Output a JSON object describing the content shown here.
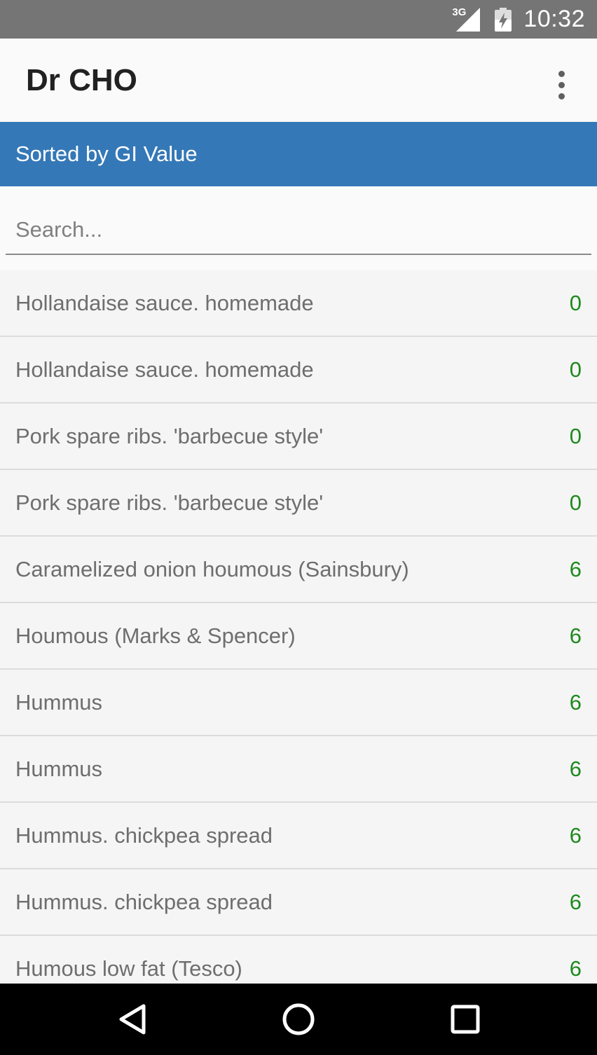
{
  "status_bar": {
    "network_type": "3G",
    "time": "10:32",
    "icons": [
      "signal-icon",
      "battery-charging-icon"
    ]
  },
  "app_bar": {
    "title": "Dr CHO",
    "menu_icon": "more-vert-icon"
  },
  "sort_banner": {
    "label": "Sorted by GI Value",
    "background": "#3478b7"
  },
  "search": {
    "placeholder": "Search...",
    "value": ""
  },
  "food_list": {
    "items": [
      {
        "name": "Hollandaise sauce. homemade",
        "gi": "0"
      },
      {
        "name": "Hollandaise sauce. homemade",
        "gi": "0"
      },
      {
        "name": "Pork spare ribs. 'barbecue style'",
        "gi": "0"
      },
      {
        "name": "Pork spare ribs. 'barbecue style'",
        "gi": "0"
      },
      {
        "name": "Caramelized onion houmous (Sainsbury)",
        "gi": "6"
      },
      {
        "name": "Houmous (Marks & Spencer)",
        "gi": "6"
      },
      {
        "name": "Hummus",
        "gi": "6"
      },
      {
        "name": "Hummus",
        "gi": "6"
      },
      {
        "name": "Hummus. chickpea spread",
        "gi": "6"
      },
      {
        "name": "Hummus. chickpea spread",
        "gi": "6"
      },
      {
        "name": "Humous low fat (Tesco)",
        "gi": "6"
      }
    ],
    "value_color": "#1e8a1e"
  },
  "nav_bar": {
    "buttons": [
      "back-icon",
      "home-icon",
      "recent-apps-icon"
    ]
  }
}
